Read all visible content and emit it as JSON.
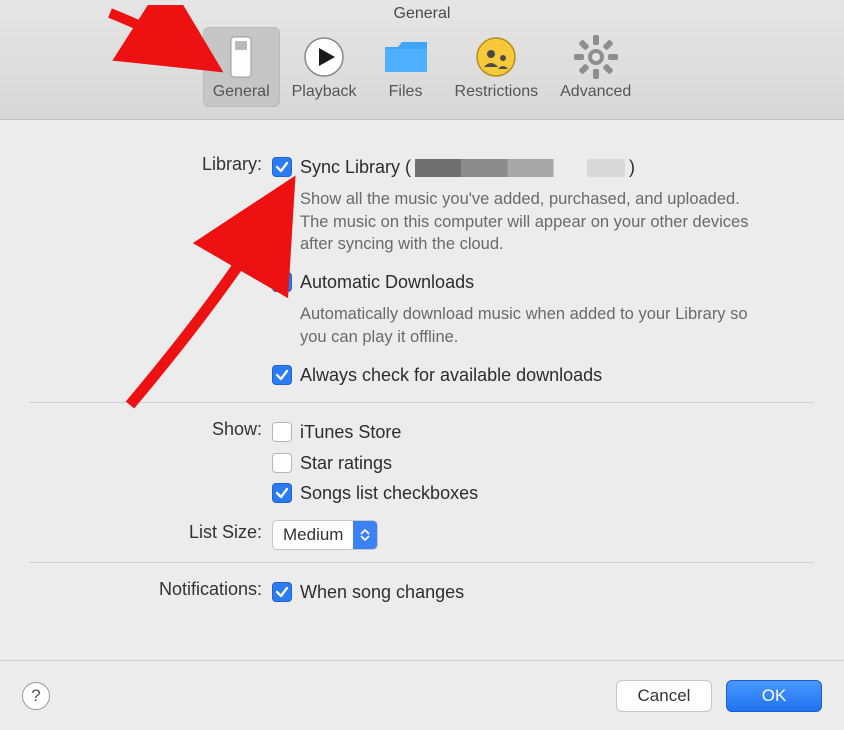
{
  "window": {
    "title": "General"
  },
  "tabs": {
    "general": "General",
    "playback": "Playback",
    "files": "Files",
    "restrictions": "Restrictions",
    "advanced": "Advanced"
  },
  "sections": {
    "library": {
      "label": "Library:",
      "sync": {
        "checked": true,
        "label_prefix": "Sync Library (",
        "label_suffix": ")",
        "desc": "Show all the music you've added, purchased, and uploaded. The music on this computer will appear on your other devices after syncing with the cloud."
      },
      "auto_dl": {
        "checked": true,
        "label": "Automatic Downloads",
        "desc": "Automatically download music when added to your Library so you can play it offline."
      },
      "always_check": {
        "checked": true,
        "label": "Always check for available downloads"
      }
    },
    "show": {
      "label": "Show:",
      "itunes_store": {
        "checked": false,
        "label": "iTunes Store"
      },
      "star_ratings": {
        "checked": false,
        "label": "Star ratings"
      },
      "songs_checkboxes": {
        "checked": true,
        "label": "Songs list checkboxes"
      }
    },
    "list_size": {
      "label": "List Size:",
      "value": "Medium"
    },
    "notifications": {
      "label": "Notifications:",
      "song_changes": {
        "checked": true,
        "label": "When song changes"
      }
    }
  },
  "footer": {
    "help": "?",
    "cancel": "Cancel",
    "ok": "OK"
  }
}
